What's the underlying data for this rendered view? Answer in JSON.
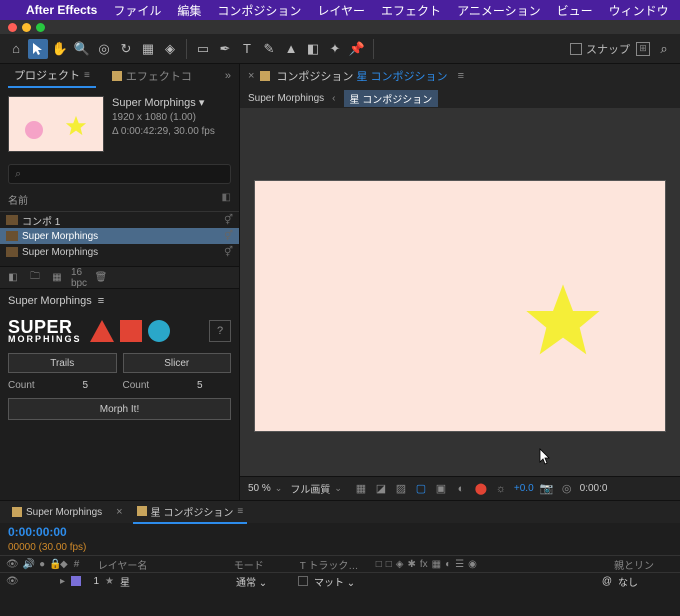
{
  "mac_menu": {
    "apple": "",
    "app": "After Effects",
    "items": [
      "ファイル",
      "編集",
      "コンポジション",
      "レイヤー",
      "エフェクト",
      "アニメーション",
      "ビュー",
      "ウィンドウ"
    ]
  },
  "toolbar": {
    "snap_label": "スナップ"
  },
  "project": {
    "tab_project": "プロジェクト",
    "tab_effects": "エフェクトコ",
    "more": "»",
    "item_name": "Super Morphings ▾",
    "dims": "1920 x 1080 (1.00)",
    "duration": "Δ 0:00:42:29, 30.00 fps",
    "search": "⌕",
    "col_name": "名前",
    "row1": "コンポ 1",
    "row2": "Super Morphings",
    "row3": "Super Morphings",
    "bpc": "16 bpc",
    "row_tag": "⚥"
  },
  "super_morphings": {
    "panel_title": "Super Morphings",
    "logo1": "SUPER",
    "logo2": "MORPHINGS",
    "help": "?",
    "trails": "Trails",
    "slicer": "Slicer",
    "count_label1": "Count",
    "count_val1": "5",
    "count_label2": "Count",
    "count_val2": "5",
    "morph": "Morph It!"
  },
  "comp": {
    "tab_prefix": "コンポジション",
    "tab_blue": "星 コンポジション",
    "crumb1": "Super Morphings",
    "crumb2": "星 コンポジション",
    "zoom": "50 %",
    "quality": "フル画質",
    "exposure": "+0.0",
    "time_readout": "0:00:0"
  },
  "timeline": {
    "tab1": "Super Morphings",
    "tab2": "星 コンポジション",
    "time": "0:00:00:00",
    "fps": "00000 (30.00 fps)",
    "col_num": "#",
    "col_name": "レイヤー名",
    "col_mode": "モード",
    "col_track": "T トラック…",
    "col_parent": "親とリン",
    "row_num": "1",
    "row_name": "星",
    "row_mode": "通常",
    "row_track": "マット",
    "row_parent": "なし",
    "row_at": "@"
  },
  "colors": {
    "canvas_bg": "#fde5dc",
    "star": "#f5ee38"
  }
}
